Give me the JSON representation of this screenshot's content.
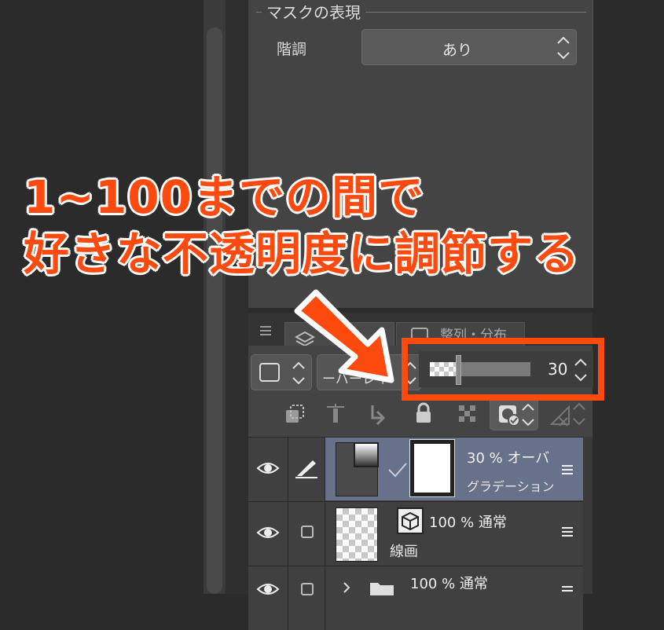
{
  "property_panel": {
    "section_title": "マスクの表現",
    "gradation_label": "階調",
    "gradation_value": "あり"
  },
  "layer_panel": {
    "tabs": [
      {
        "label": ""
      },
      {
        "label": "整列・分布"
      }
    ],
    "blend_mode_partial": "ーバーレイ",
    "opacity_value": "30",
    "layers": [
      {
        "opacity": "30 %",
        "blend": "オーバ",
        "name": "グラデーション",
        "selected": true
      },
      {
        "opacity": "100 %",
        "blend": "通常",
        "name": "線画",
        "selected": false
      },
      {
        "opacity": "100 %",
        "blend": "通常",
        "name": "",
        "selected": false,
        "is_folder": true
      }
    ]
  },
  "annotation": {
    "line1": "1~100までの間で",
    "line2": "好きな不透明度に調節する",
    "accent_color": "#ff4a0f"
  },
  "icons": [
    "eye-icon",
    "pen-icon",
    "check-icon",
    "menu-icon",
    "folder-icon",
    "chevron-right-icon",
    "lock-icon",
    "clip-icon",
    "cube-icon"
  ]
}
